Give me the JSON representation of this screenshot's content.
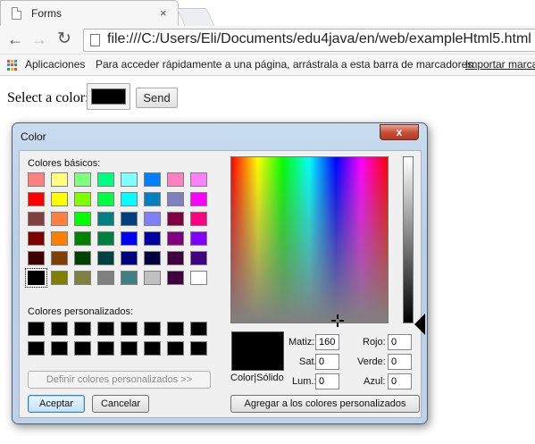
{
  "browser": {
    "tab_title": "Forms",
    "tab_close": "×",
    "address_bar": "file:///C:/Users/Eli/Documents/edu4java/en/web/exampleHtml5.html",
    "bookmarks_bar": {
      "apps_label": "Aplicaciones",
      "hint": "Para acceder rápidamente a una página, arrástrala a esta barra de marcadores.",
      "import_link": "Importar marca"
    }
  },
  "page": {
    "form_label": "Select a color:",
    "color_value": "#000000",
    "send_button": "Send"
  },
  "dialog": {
    "title": "Color",
    "close_glyph": "x",
    "basic_colors_label": "Colores básicos:",
    "custom_colors_label": "Colores personalizados:",
    "basic_colors": [
      "#ff8080",
      "#ffff80",
      "#80ff80",
      "#00ff80",
      "#80ffff",
      "#0080ff",
      "#ff80c0",
      "#ff80ff",
      "#ff0000",
      "#ffff00",
      "#80ff00",
      "#00ff40",
      "#00ffff",
      "#0080c0",
      "#8080c0",
      "#ff00ff",
      "#804040",
      "#ff8040",
      "#00ff00",
      "#008080",
      "#004080",
      "#8080ff",
      "#800040",
      "#ff0080",
      "#800000",
      "#ff8000",
      "#008000",
      "#008040",
      "#0000ff",
      "#0000a0",
      "#800080",
      "#8000ff",
      "#400000",
      "#804000",
      "#004000",
      "#004040",
      "#000080",
      "#000040",
      "#400040",
      "#400080",
      "#000000",
      "#808000",
      "#808040",
      "#808080",
      "#408080",
      "#c0c0c0",
      "#400040",
      "#ffffff"
    ],
    "selected_basic_index": 40,
    "custom_colors": [
      "#000000",
      "#000000",
      "#000000",
      "#000000",
      "#000000",
      "#000000",
      "#000000",
      "#000000",
      "#000000",
      "#000000",
      "#000000",
      "#000000",
      "#000000",
      "#000000",
      "#000000",
      "#000000"
    ],
    "define_custom_button": "Definir colores personalizados >>",
    "ok_button": "Aceptar",
    "cancel_button": "Cancelar",
    "color_solid_label": "Color|Sólido",
    "hue_label": "Matiz:",
    "hue_value": "160",
    "sat_label": "Sat.:",
    "sat_value": "0",
    "lum_label": "Lum.:",
    "lum_value": "0",
    "red_label": "Rojo:",
    "red_value": "0",
    "green_label": "Verde:",
    "green_value": "0",
    "blue_label": "Azul:",
    "blue_value": "0",
    "add_custom_button": "Agregar a los colores personalizados",
    "current_color": "#000000"
  }
}
